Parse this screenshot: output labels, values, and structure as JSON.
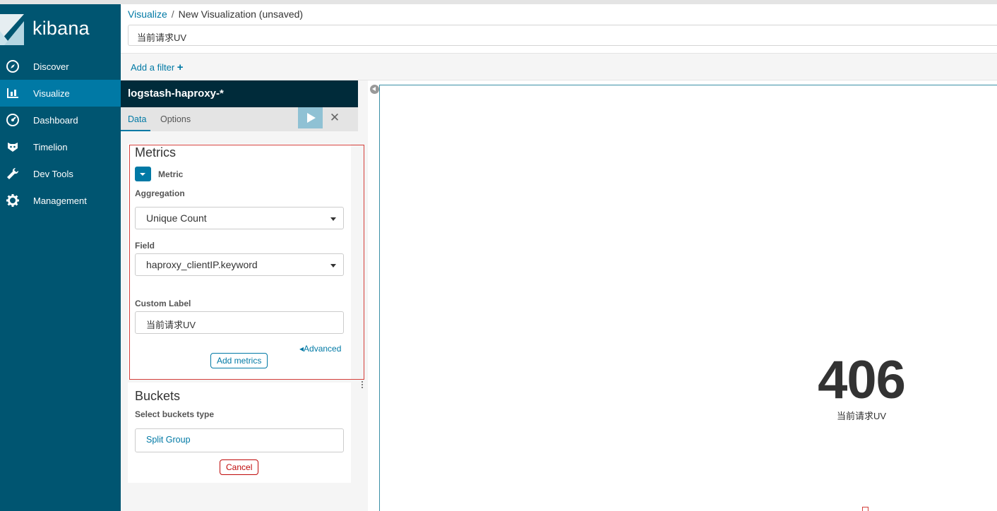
{
  "app": {
    "name": "kibana"
  },
  "sidebar": {
    "items": [
      {
        "label": "Discover",
        "icon": "compass-icon",
        "active": false
      },
      {
        "label": "Visualize",
        "icon": "bar-chart-icon",
        "active": true
      },
      {
        "label": "Dashboard",
        "icon": "gauge-icon",
        "active": false
      },
      {
        "label": "Timelion",
        "icon": "timelion-icon",
        "active": false
      },
      {
        "label": "Dev Tools",
        "icon": "wrench-icon",
        "active": false
      },
      {
        "label": "Management",
        "icon": "gear-icon",
        "active": false
      }
    ]
  },
  "header": {
    "breadcrumb_link": "Visualize",
    "breadcrumb_separator": "/",
    "breadcrumb_current": "New Visualization (unsaved)",
    "title_value": "当前请求UV",
    "add_filter_label": "Add a filter",
    "add_filter_plus": "+"
  },
  "editor": {
    "index_pattern": "logstash-haproxy-*",
    "tabs": [
      {
        "label": "Data",
        "active": true
      },
      {
        "label": "Options",
        "active": false
      }
    ],
    "close_symbol": "✕",
    "metrics": {
      "title": "Metrics",
      "metric_label": "Metric",
      "aggregation_label": "Aggregation",
      "aggregation_value": "Unique Count",
      "field_label": "Field",
      "field_value": "haproxy_clientIP.keyword",
      "custom_label_label": "Custom Label",
      "custom_label_value": "当前请求UV",
      "advanced_label": "Advanced",
      "advanced_arrow": "◂",
      "add_metrics_label": "Add metrics"
    },
    "buckets": {
      "title": "Buckets",
      "select_type_label": "Select buckets type",
      "split_group_label": "Split Group",
      "cancel_label": "Cancel"
    }
  },
  "visualization": {
    "metric_value": "406",
    "metric_label": "当前请求UV"
  },
  "colors": {
    "sidebar": "#005571",
    "sidebar_active": "#0079a5",
    "index_bar": "#002b3a",
    "accent": "#0079a5",
    "highlight_box": "#d43f3a"
  }
}
